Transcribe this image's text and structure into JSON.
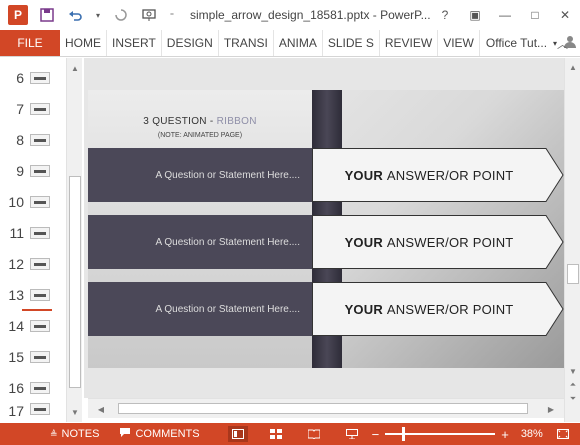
{
  "titlebar": {
    "app_logo": "P",
    "title": "simple_arrow_design_18581.pptx - PowerP...",
    "icons": [
      "save-icon",
      "undo-icon",
      "undo-dropdown-icon",
      "redo-icon",
      "present-icon",
      "customize-qat-icon"
    ],
    "controls": [
      "?",
      "▣",
      "—",
      "□",
      "✕"
    ]
  },
  "ribbon": {
    "file_label": "FILE",
    "tabs": [
      "HOME",
      "INSERT",
      "DESIGN",
      "TRANSI",
      "ANIMA",
      "SLIDE S",
      "REVIEW",
      "VIEW"
    ],
    "account": "Office Tut...",
    "collapse_glyph": "︿"
  },
  "thumbnails": [
    {
      "num": "6"
    },
    {
      "num": "7"
    },
    {
      "num": "8"
    },
    {
      "num": "9"
    },
    {
      "num": "10"
    },
    {
      "num": "11"
    },
    {
      "num": "12"
    },
    {
      "num": "13"
    },
    {
      "num": "14"
    },
    {
      "num": "15"
    },
    {
      "num": "16"
    },
    {
      "num": "17"
    }
  ],
  "slide": {
    "title_main": "3 QUESTION - ",
    "title_accent": "RIBBON",
    "subtitle": "(NOTE: ANIMATED PAGE)",
    "rows": [
      {
        "question": "A Question or Statement Here....",
        "answer_bold": "YOUR",
        "answer_rest": "ANSWER/OR POINT"
      },
      {
        "question": "A Question or Statement Here....",
        "answer_bold": "YOUR",
        "answer_rest": "ANSWER/OR POINT"
      },
      {
        "question": "A Question or Statement Here....",
        "answer_bold": "YOUR",
        "answer_rest": "ANSWER/OR POINT"
      }
    ],
    "colors": {
      "question_fill": "#4b4858",
      "strip": "#2e2c38",
      "answer_fill": "#f4f4f4"
    }
  },
  "statusbar": {
    "notes_label": "NOTES",
    "comments_label": "COMMENTS",
    "zoom_percent": "38%",
    "zoom_level": 0.38,
    "zoom_minus": "−",
    "zoom_plus": "+",
    "accent": "#d24726"
  }
}
